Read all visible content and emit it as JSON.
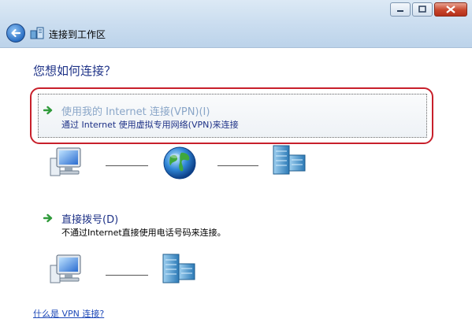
{
  "window": {
    "title": "连接到工作区",
    "controls": {
      "minimize": "minimize-icon",
      "maximize": "maximize-icon",
      "close": "close-icon"
    }
  },
  "main": {
    "question": "您想如何连接？",
    "options": [
      {
        "title": "使用我的 Internet 连接(VPN)(I)",
        "description": "通过 Internet 使用虚拟专用网络(VPN)来连接",
        "diagram": [
          "computer-icon",
          "globe-icon",
          "server-icon"
        ]
      },
      {
        "title": "直接拨号(D)",
        "description": "不通过Internet直接使用电话号码来连接。",
        "diagram": [
          "computer-icon",
          "server-icon"
        ]
      }
    ],
    "help_link": "什么是 VPN 连接?"
  },
  "colors": {
    "highlight_frame": "#c8202b",
    "heading": "#1e3287",
    "link": "#1e49b8",
    "arrow": "#2f9a3a"
  }
}
